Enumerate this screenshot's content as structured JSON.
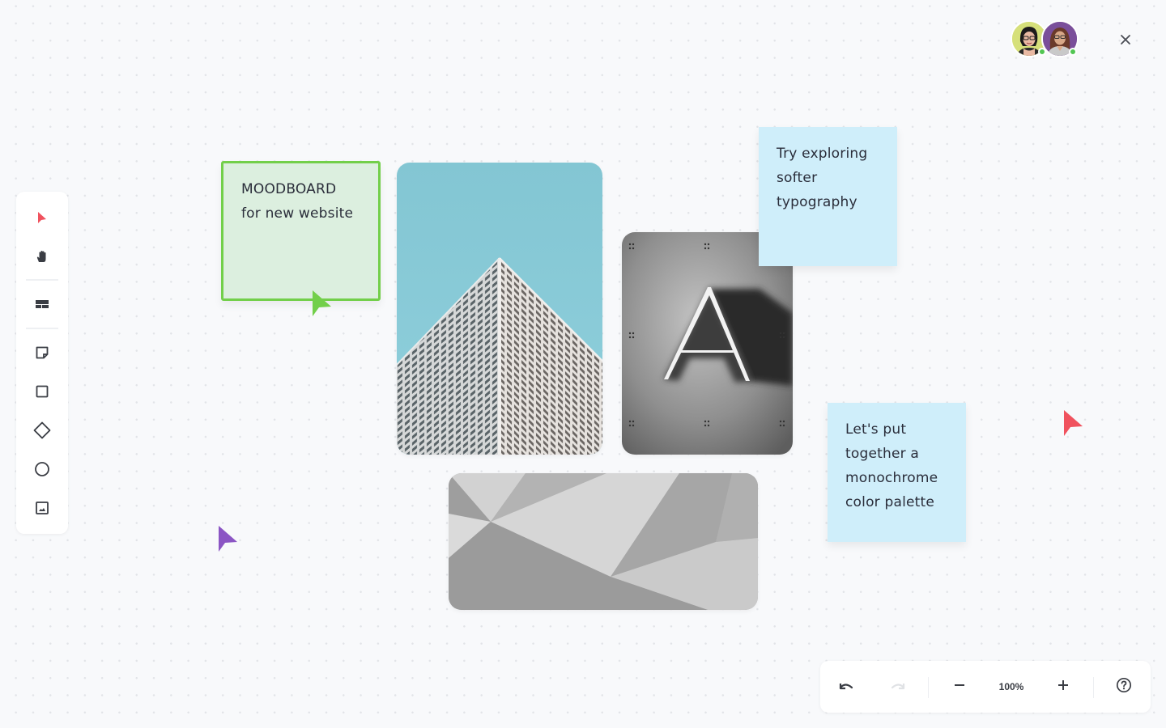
{
  "toolbar": {
    "tools": [
      {
        "name": "select-tool",
        "icon": "pointer-icon",
        "active": true
      },
      {
        "name": "hand-tool",
        "icon": "hand-icon"
      },
      {
        "name": "template-tool",
        "icon": "layout-icon"
      },
      {
        "name": "sticky-note-tool",
        "icon": "sticky-note-icon"
      },
      {
        "name": "rectangle-tool",
        "icon": "square-icon"
      },
      {
        "name": "diamond-tool",
        "icon": "diamond-icon"
      },
      {
        "name": "circle-tool",
        "icon": "circle-icon"
      },
      {
        "name": "image-tool",
        "icon": "image-icon"
      }
    ],
    "accent_color": "#f0525e"
  },
  "header": {
    "collaborators": [
      {
        "name": "collaborator-1",
        "background": "#d6e07a",
        "online": true
      },
      {
        "name": "collaborator-2",
        "background": "#7a4f9a",
        "online": true
      }
    ],
    "close_icon": "close-icon"
  },
  "board": {
    "notes": [
      {
        "id": "moodboard-note",
        "lines": [
          "MOODBOARD",
          "for new website"
        ],
        "color": "#dcefdf",
        "border": "#72cf4a"
      },
      {
        "id": "typography-note",
        "lines": [
          "Try exploring",
          "softer",
          "typography"
        ],
        "color": "#cfeefa"
      },
      {
        "id": "palette-note",
        "lines": [
          "Let's put",
          "together a",
          "monochrome",
          "color palette"
        ],
        "color": "#cfeefa"
      }
    ],
    "images": [
      {
        "id": "building-image",
        "subject": "skyscraper corner against blue sky"
      },
      {
        "id": "letter-a-image",
        "subject": "3D letter A on grey texture"
      },
      {
        "id": "polygon-image",
        "subject": "grey low-poly abstract"
      }
    ],
    "cursors": [
      {
        "id": "green-cursor",
        "color": "#72cf4a"
      },
      {
        "id": "red-cursor",
        "color": "#f0525e"
      },
      {
        "id": "purple-cursor",
        "color": "#8b55c4"
      }
    ]
  },
  "controls": {
    "undo_icon": "undo-icon",
    "redo_icon": "redo-icon",
    "zoom_out_icon": "minus-icon",
    "zoom_level": "100%",
    "zoom_in_icon": "plus-icon",
    "help_icon": "help-icon"
  }
}
